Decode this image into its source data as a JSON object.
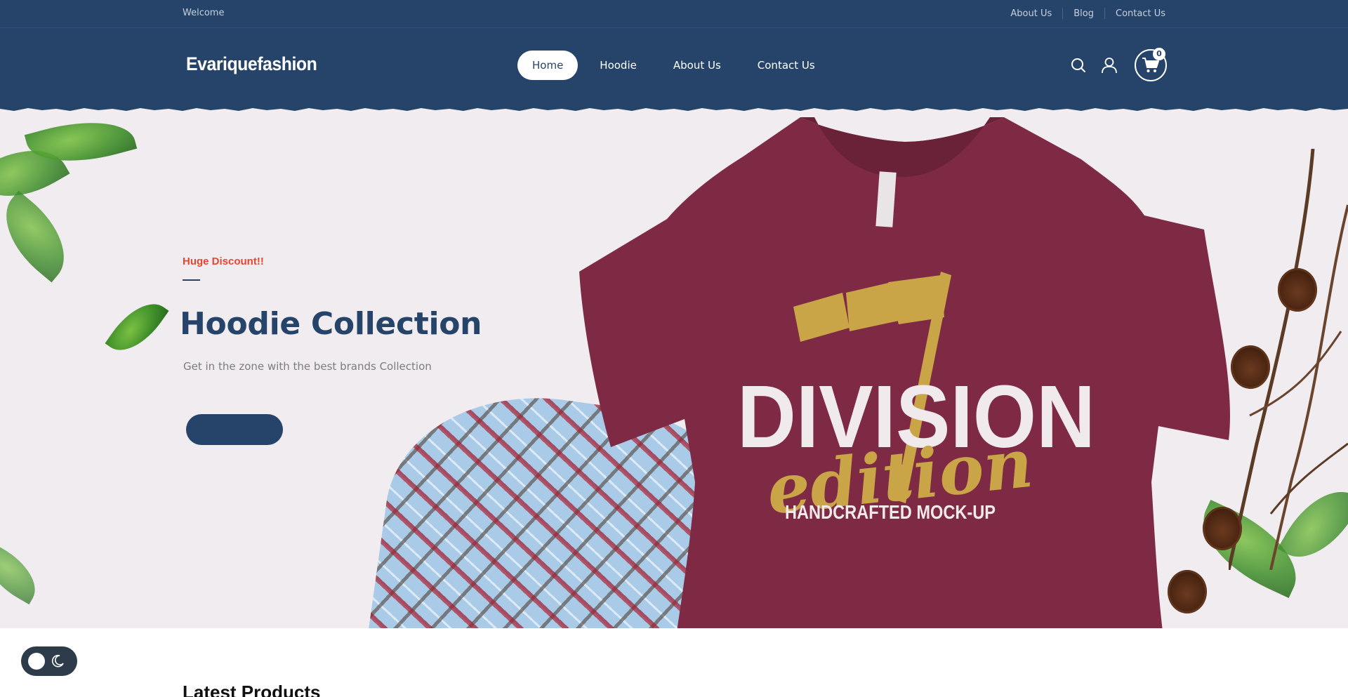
{
  "topbar": {
    "welcome": "Welcome",
    "links": [
      "About Us",
      "Blog",
      "Contact Us"
    ]
  },
  "header": {
    "logo": "Evariquefashion",
    "nav": [
      "Home",
      "Hoodie",
      "About Us",
      "Contact Us"
    ],
    "active_nav": "Home",
    "icons": [
      "search-icon",
      "user-icon",
      "cart-icon"
    ],
    "cart_count": "0"
  },
  "hero": {
    "tagline": "Huge Discount!!",
    "title": "Hoodie Collection",
    "subtitle": "Get in the zone with the best brands Collection",
    "cta_label": "",
    "shirt_print": {
      "line1": "DIVISION",
      "line2": "edition",
      "line3": "HANDCRAFTED MOCK-UP"
    }
  },
  "section": {
    "title": "Latest Products"
  },
  "theme_toggle": {
    "icons": [
      "sun-knob",
      "moon-icon"
    ]
  },
  "colors": {
    "brand": "#264469",
    "accent": "#e5462f",
    "hero_bg": "#f1ecef",
    "shirt": "#7e2a45",
    "print_gold": "#c9a547"
  }
}
